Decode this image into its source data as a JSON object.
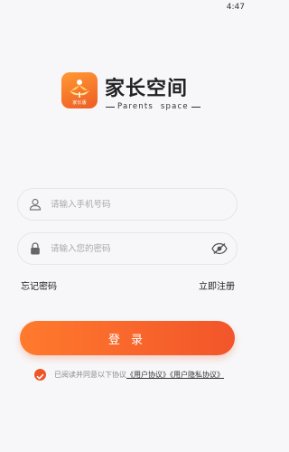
{
  "status_bar": {
    "time": "4:47"
  },
  "brand": {
    "name": "家长空间",
    "subtitle": "Parents  space",
    "logo_caption": "家长版"
  },
  "login_form": {
    "phone_placeholder": "请输入手机号码",
    "password_placeholder": "请输入您的密码",
    "phone_value": "",
    "password_value": ""
  },
  "links": {
    "forgot_password": "忘记密码",
    "register_now": "立即注册"
  },
  "login_button": "登 录",
  "agreement": {
    "checked": true,
    "prefix": "已阅读并同意以下协议",
    "user_agreement": "《用户协议》",
    "privacy_agreement": "《用户隐私协议》"
  },
  "colors": {
    "accent": "#f2552a",
    "accent_light": "#ff7a2d",
    "background": "#f7f7f9",
    "border": "#e6e6ea",
    "placeholder": "#a8a8ae"
  },
  "icons": {
    "phone_field": "user-icon",
    "password_field": "lock-icon",
    "password_visibility": "eye-off-icon",
    "agreement_check": "check-circle-icon"
  }
}
